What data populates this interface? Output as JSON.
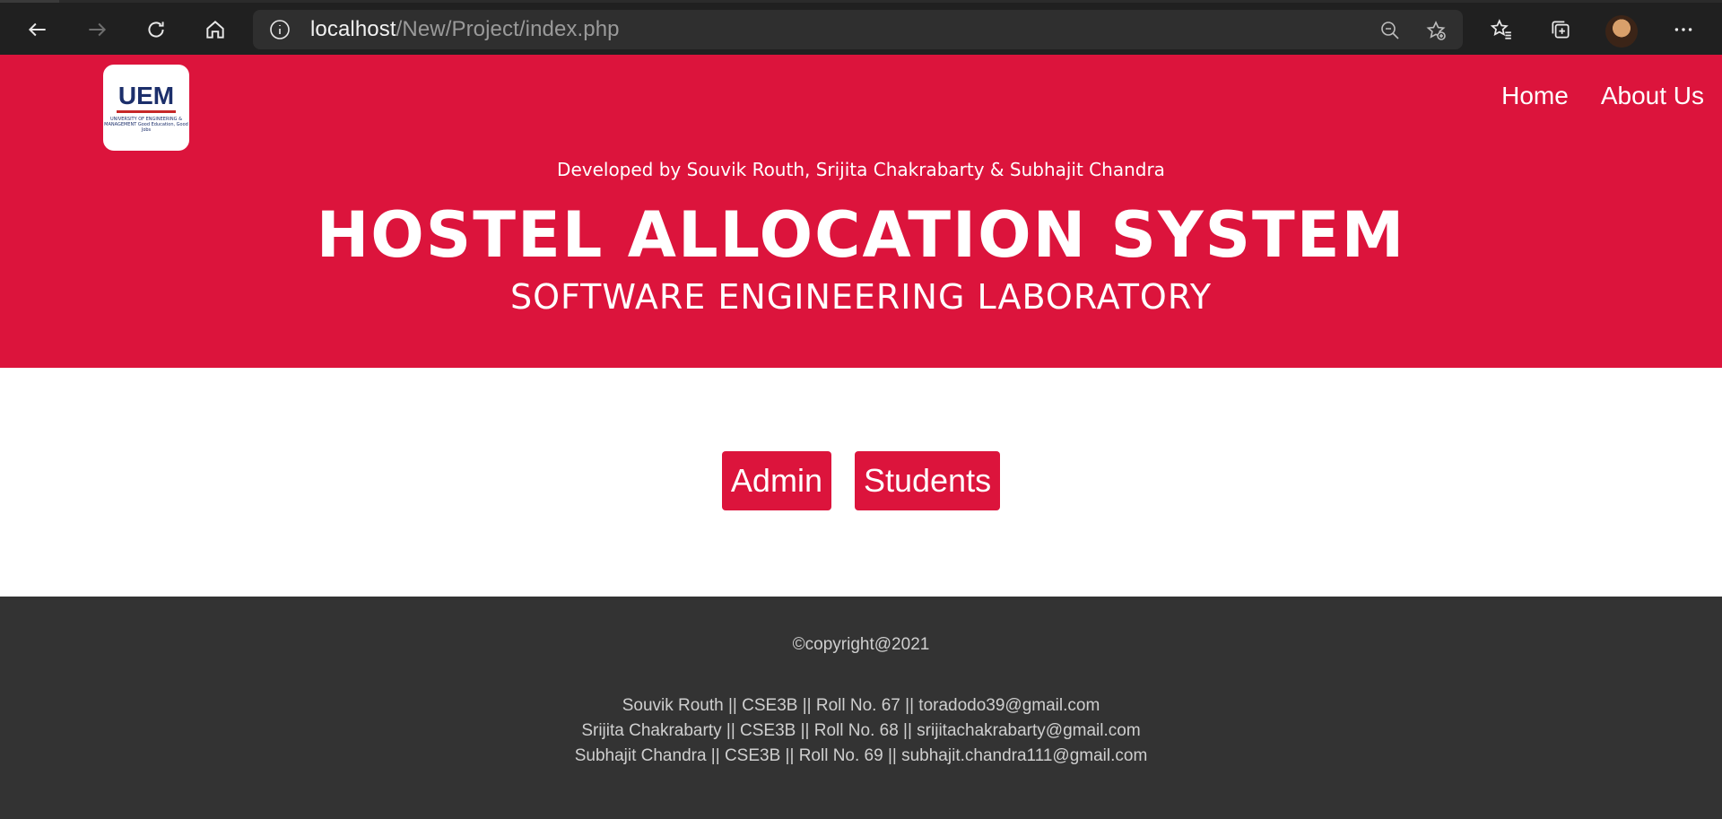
{
  "browser": {
    "url_host": "localhost",
    "url_path": "/New/Project/index.php"
  },
  "header": {
    "logo_text": "UEM",
    "logo_subtext": "UNIVERSITY OF ENGINEERING & MANAGEMENT Good Education, Good Jobs",
    "nav": [
      "Home",
      "About Us"
    ],
    "developed_by": "Developed by Souvik Routh, Srijita Chakrabarty & Subhajit Chandra",
    "title": "HOSTEL ALLOCATION SYSTEM",
    "subtitle": "SOFTWARE ENGINEERING LABORATORY"
  },
  "main": {
    "buttons": [
      "Admin",
      "Students"
    ]
  },
  "footer": {
    "copyright": "©copyright@2021",
    "credits": [
      "Souvik Routh || CSE3B || Roll No. 67 || toradodo39@gmail.com",
      "Srijita Chakrabarty || CSE3B || Roll No. 68 || srijitachakrabarty@gmail.com",
      "Subhajit Chandra || CSE3B || Roll No. 69 || subhajit.chandra111@gmail.com"
    ]
  },
  "colors": {
    "accent": "#dc143c",
    "footer_bg": "#333333",
    "chrome_bg": "#202020"
  }
}
